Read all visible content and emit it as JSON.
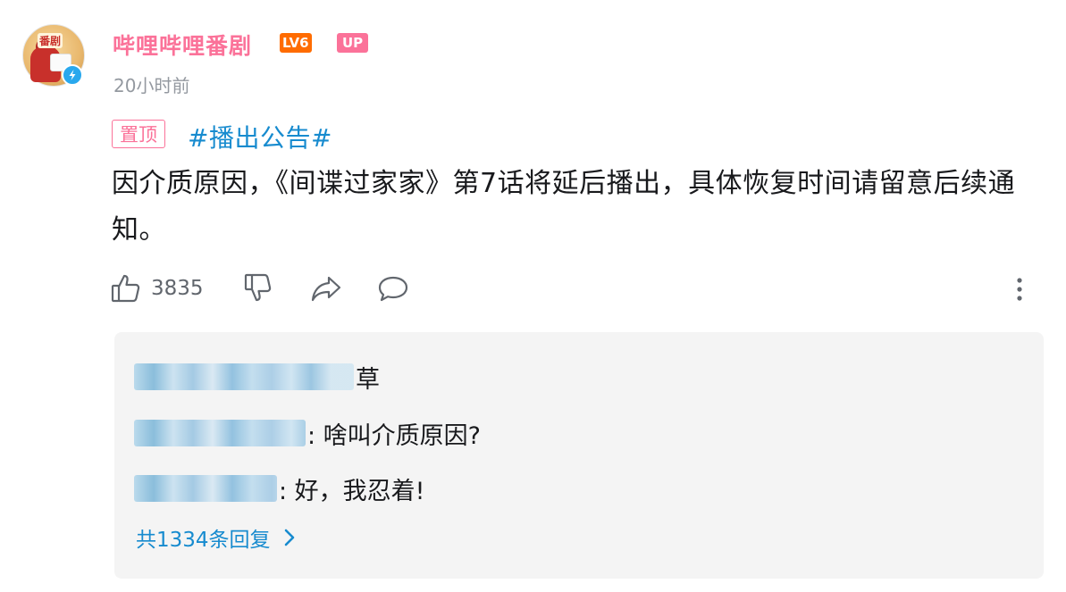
{
  "post": {
    "author": {
      "name": "哔哩哔哩番剧",
      "level": "LV6",
      "up_badge": "UP",
      "avatar_tag": "番剧",
      "time": "20小时前",
      "verified": true
    },
    "pin_label": "置顶",
    "topic": "#播出公告#",
    "content": "因介质原因，《间谍过家家》第7话将延后播出，具体恢复时间请留意后续通知。",
    "likes": "3835",
    "icons": {
      "like": "thumbs-up-icon",
      "dislike": "thumbs-down-icon",
      "share": "share-icon",
      "comment": "comment-icon",
      "more": "more-vertical-icon"
    }
  },
  "replies": {
    "items": [
      {
        "username_hidden": true,
        "text": "草"
      },
      {
        "username_hidden": true,
        "text": ": 啥叫介质原因?"
      },
      {
        "username_hidden": true,
        "text": ": 好，我忍着!"
      }
    ],
    "more_label": "共1334条回复"
  },
  "colors": {
    "brand_pink": "#fb7299",
    "level_orange": "#ff6c00",
    "link_blue": "#178bcf",
    "muted_gray": "#9499a0",
    "panel_bg": "#f4f4f4"
  }
}
